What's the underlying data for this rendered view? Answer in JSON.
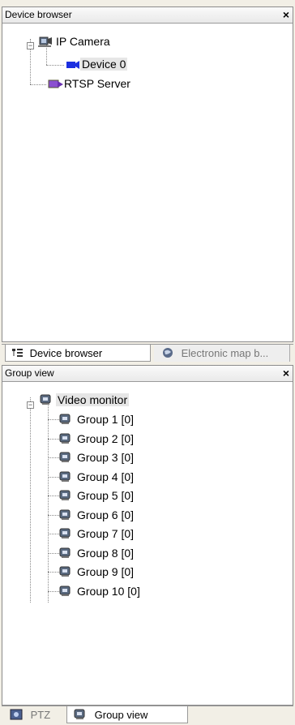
{
  "device_browser": {
    "title": "Device browser",
    "close": "×",
    "tree": {
      "root_ip": "IP Camera",
      "device0": "Device 0",
      "rtsp": "RTSP Server"
    },
    "tabs": {
      "device_browser": "Device browser",
      "electronic_map": "Electronic map b..."
    }
  },
  "group_view": {
    "title": "Group view",
    "close": "×",
    "root": "Video monitor",
    "groups": [
      "Group 1 [0]",
      "Group 2 [0]",
      "Group 3 [0]",
      "Group 4 [0]",
      "Group 5 [0]",
      "Group 6 [0]",
      "Group 7 [0]",
      "Group 8 [0]",
      "Group 9 [0]",
      "Group 10 [0]"
    ],
    "tabs": {
      "ptz": "PTZ",
      "group_view": "Group view"
    }
  },
  "colors": {
    "camera_blue": "#1b2fe0",
    "rtsp_purple": "#8a4fd0",
    "monitor_gray": "#5a6a80"
  },
  "expander_symbol": "−"
}
